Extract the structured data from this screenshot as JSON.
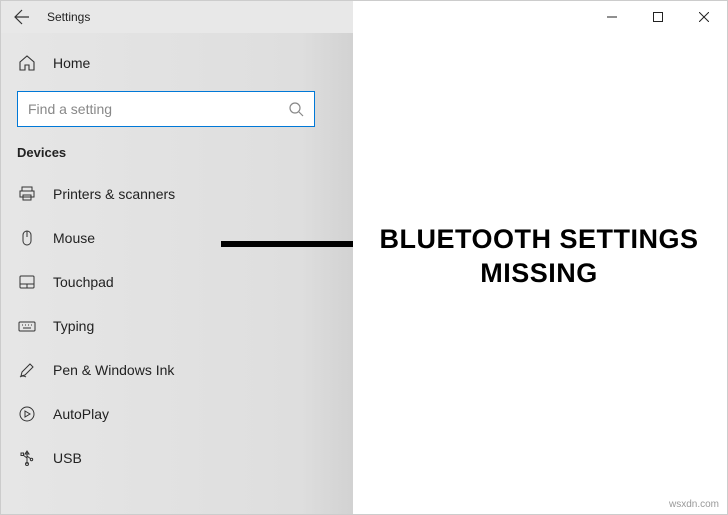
{
  "titlebar": {
    "title": "Settings"
  },
  "sidebar": {
    "home_label": "Home",
    "search_placeholder": "Find a setting",
    "section_header": "Devices",
    "items": [
      {
        "label": "Printers & scanners"
      },
      {
        "label": "Mouse"
      },
      {
        "label": "Touchpad"
      },
      {
        "label": "Typing"
      },
      {
        "label": "Pen & Windows Ink"
      },
      {
        "label": "AutoPlay"
      },
      {
        "label": "USB"
      }
    ]
  },
  "annotation": {
    "line1": "BLUETOOTH SETTINGS",
    "line2": "MISSING"
  },
  "watermark": "wsxdn.com"
}
